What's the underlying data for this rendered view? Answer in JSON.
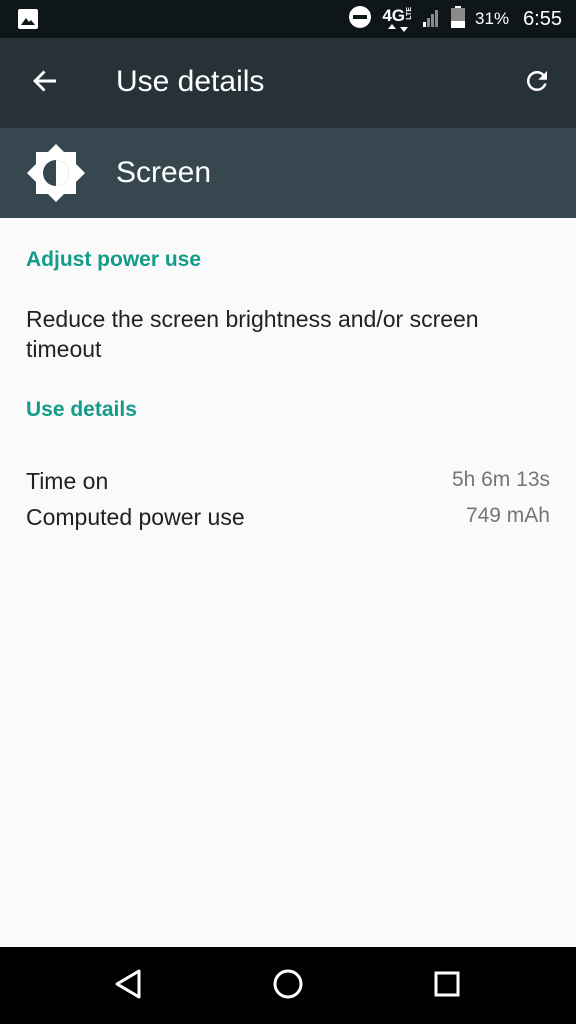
{
  "status_bar": {
    "network": "4G",
    "network_sub": "LTE",
    "battery_percent": "31%",
    "time": "6:55",
    "icons": [
      "gallery-icon",
      "do-not-disturb-icon",
      "lte-icon",
      "signal-icon",
      "battery-icon"
    ]
  },
  "app_bar": {
    "title": "Use details",
    "back_icon": "arrow-back-icon",
    "refresh_icon": "refresh-icon"
  },
  "header": {
    "title": "Screen",
    "icon": "brightness-icon"
  },
  "sections": {
    "adjust_label": "Adjust power use",
    "adjust_text": "Reduce the screen brightness and/or screen timeout",
    "use_details_label": "Use details",
    "rows": [
      {
        "label": "Time on",
        "value": "5h 6m 13s"
      },
      {
        "label": "Computed power use",
        "value": "749 mAh"
      }
    ]
  },
  "colors": {
    "status_bar": "#0f1619",
    "app_bar": "#263238",
    "header_band": "#37474f",
    "accent": "#129c8a",
    "background": "#fafafa"
  }
}
